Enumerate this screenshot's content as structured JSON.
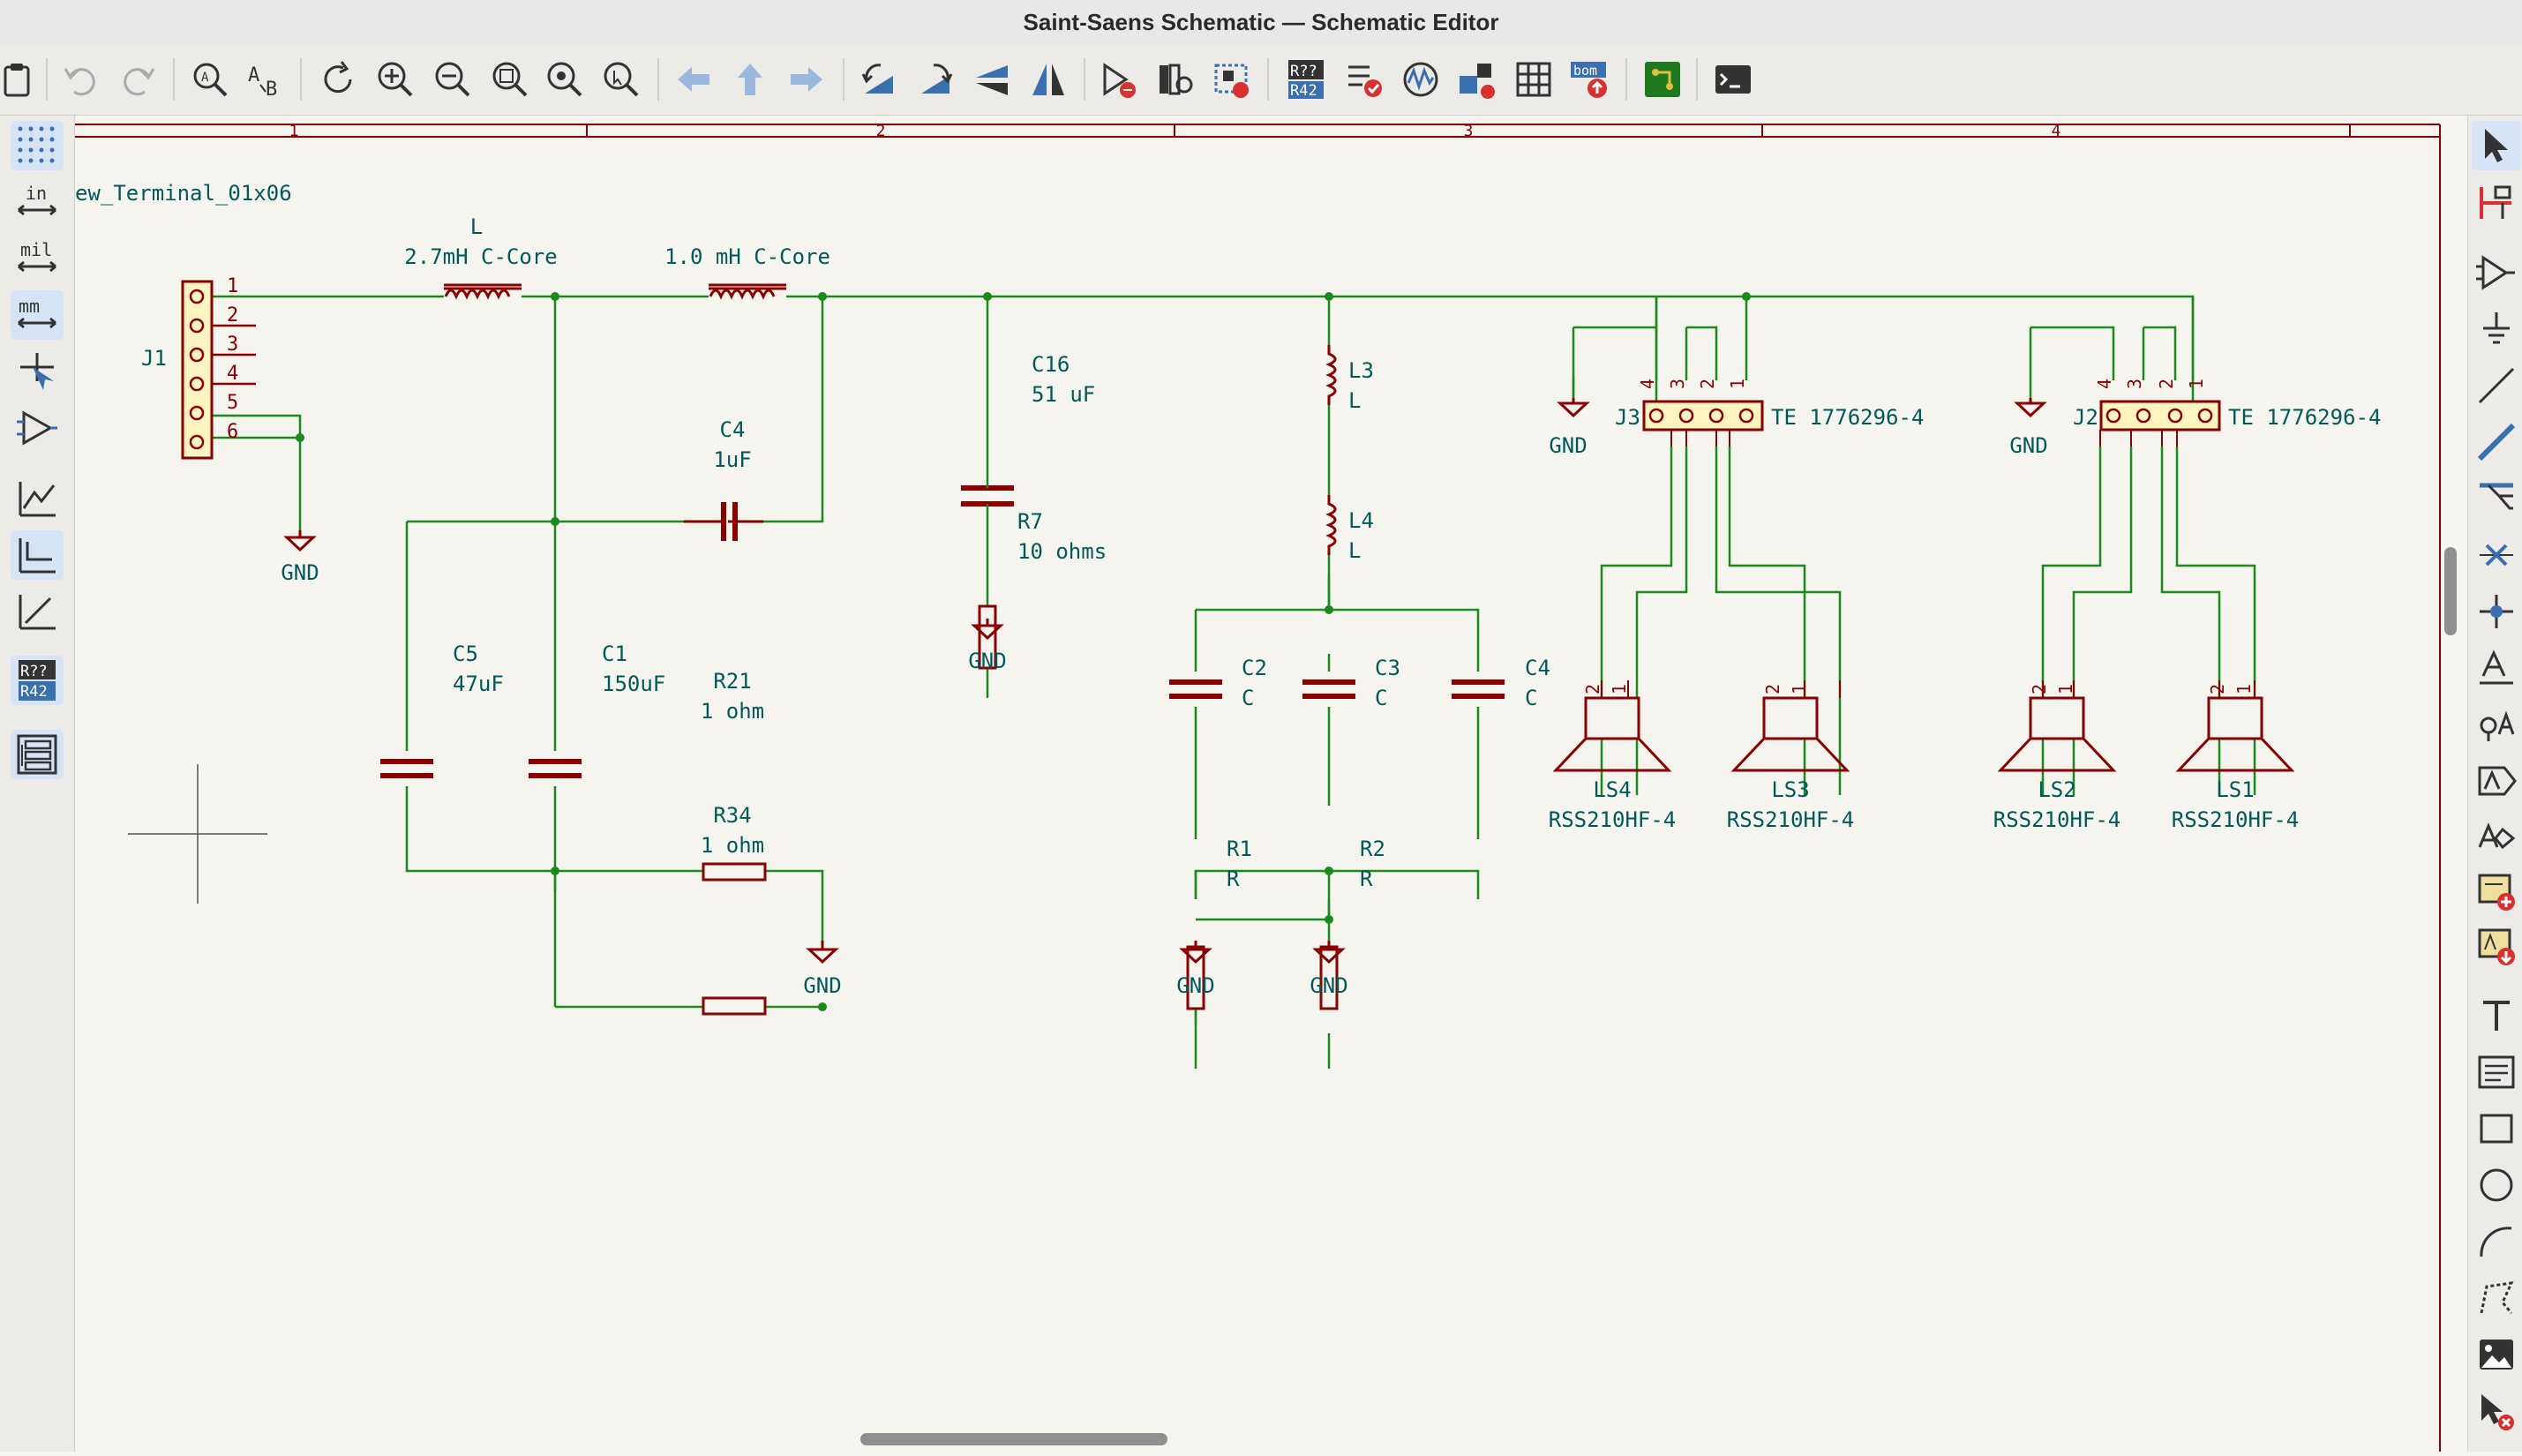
{
  "window": {
    "title": "Saint-Saens Schematic — Schematic Editor"
  },
  "colors": {
    "wire": "#1a8a1a",
    "component": "#8b0000",
    "label": "#005a5a",
    "background": "#f5f4ef",
    "pin_body": "#fff5c0"
  },
  "toolbar": {
    "items": [
      "paste-icon",
      "undo-icon",
      "redo-icon",
      "find-icon",
      "find-replace-icon",
      "refresh-icon",
      "zoom-in-icon",
      "zoom-out-icon",
      "zoom-fit-icon",
      "zoom-objects-icon",
      "zoom-selection-icon",
      "navigate-back-icon",
      "navigate-up-icon",
      "navigate-forward-icon",
      "rotate-ccw-icon",
      "rotate-cw-icon",
      "mirror-vertical-icon",
      "mirror-horizontal-icon",
      "symbol-editor-icon",
      "symbol-browser-icon",
      "footprint-assign-icon",
      "annotate-icon",
      "erc-icon",
      "simulator-icon",
      "netlist-icon",
      "bom-table-icon",
      "bom-icon",
      "pcb-editor-icon",
      "scripting-console-icon"
    ],
    "annotate_badge_top": "R??",
    "annotate_badge_bottom": "R42",
    "bom_badge": "bom"
  },
  "left_toolbar": {
    "unit_in": "in",
    "unit_mil": "mil",
    "unit_mm": "mm",
    "annotate_top": "R??",
    "annotate_bottom": "R42"
  },
  "sheet": {
    "border_columns": [
      "1",
      "2",
      "3",
      "4"
    ]
  },
  "schematic": {
    "header_label": "ew_Terminal_01x06",
    "j1": {
      "ref": "J1",
      "pins": [
        "1",
        "2",
        "3",
        "4",
        "5",
        "6"
      ]
    },
    "inductor_l": {
      "ref": "L",
      "value": "2.7mH C-Core"
    },
    "inductor_1mh": {
      "value": "1.0 mH C-Core"
    },
    "c4_top": {
      "ref": "C4",
      "value": "1uF"
    },
    "c5": {
      "ref": "C5",
      "value": "47uF"
    },
    "c1": {
      "ref": "C1",
      "value": "150uF"
    },
    "r21": {
      "ref": "R21",
      "value": "1 ohm"
    },
    "r34": {
      "ref": "R34",
      "value": "1 ohm"
    },
    "c16": {
      "ref": "C16",
      "value": "51 uF"
    },
    "r7": {
      "ref": "R7",
      "value": "10 ohms"
    },
    "l3": {
      "ref": "L3",
      "value": "L"
    },
    "l4": {
      "ref": "L4",
      "value": "L"
    },
    "c2": {
      "ref": "C2",
      "value": "C"
    },
    "c3": {
      "ref": "C3",
      "value": "C"
    },
    "c4_right": {
      "ref": "C4",
      "value": "C"
    },
    "r1": {
      "ref": "R1",
      "value": "R"
    },
    "r2": {
      "ref": "R2",
      "value": "R"
    },
    "j3": {
      "ref": "J3",
      "value": "TE 1776296-4",
      "pins": [
        "4",
        "3",
        "2",
        "1"
      ]
    },
    "j2": {
      "ref": "J2",
      "value": "TE 1776296-4",
      "pins": [
        "4",
        "3",
        "2",
        "1"
      ]
    },
    "ls4": {
      "ref": "LS4",
      "value": "RSS210HF-4",
      "pins": [
        "2",
        "1"
      ]
    },
    "ls3": {
      "ref": "LS3",
      "value": "RSS210HF-4",
      "pins": [
        "2",
        "1"
      ]
    },
    "ls2": {
      "ref": "LS2",
      "value": "RSS210HF-4",
      "pins": [
        "2",
        "1"
      ]
    },
    "ls1": {
      "ref": "LS1",
      "value": "RSS210HF-4",
      "pins": [
        "2",
        "1"
      ]
    },
    "gnd_label": "GND"
  }
}
